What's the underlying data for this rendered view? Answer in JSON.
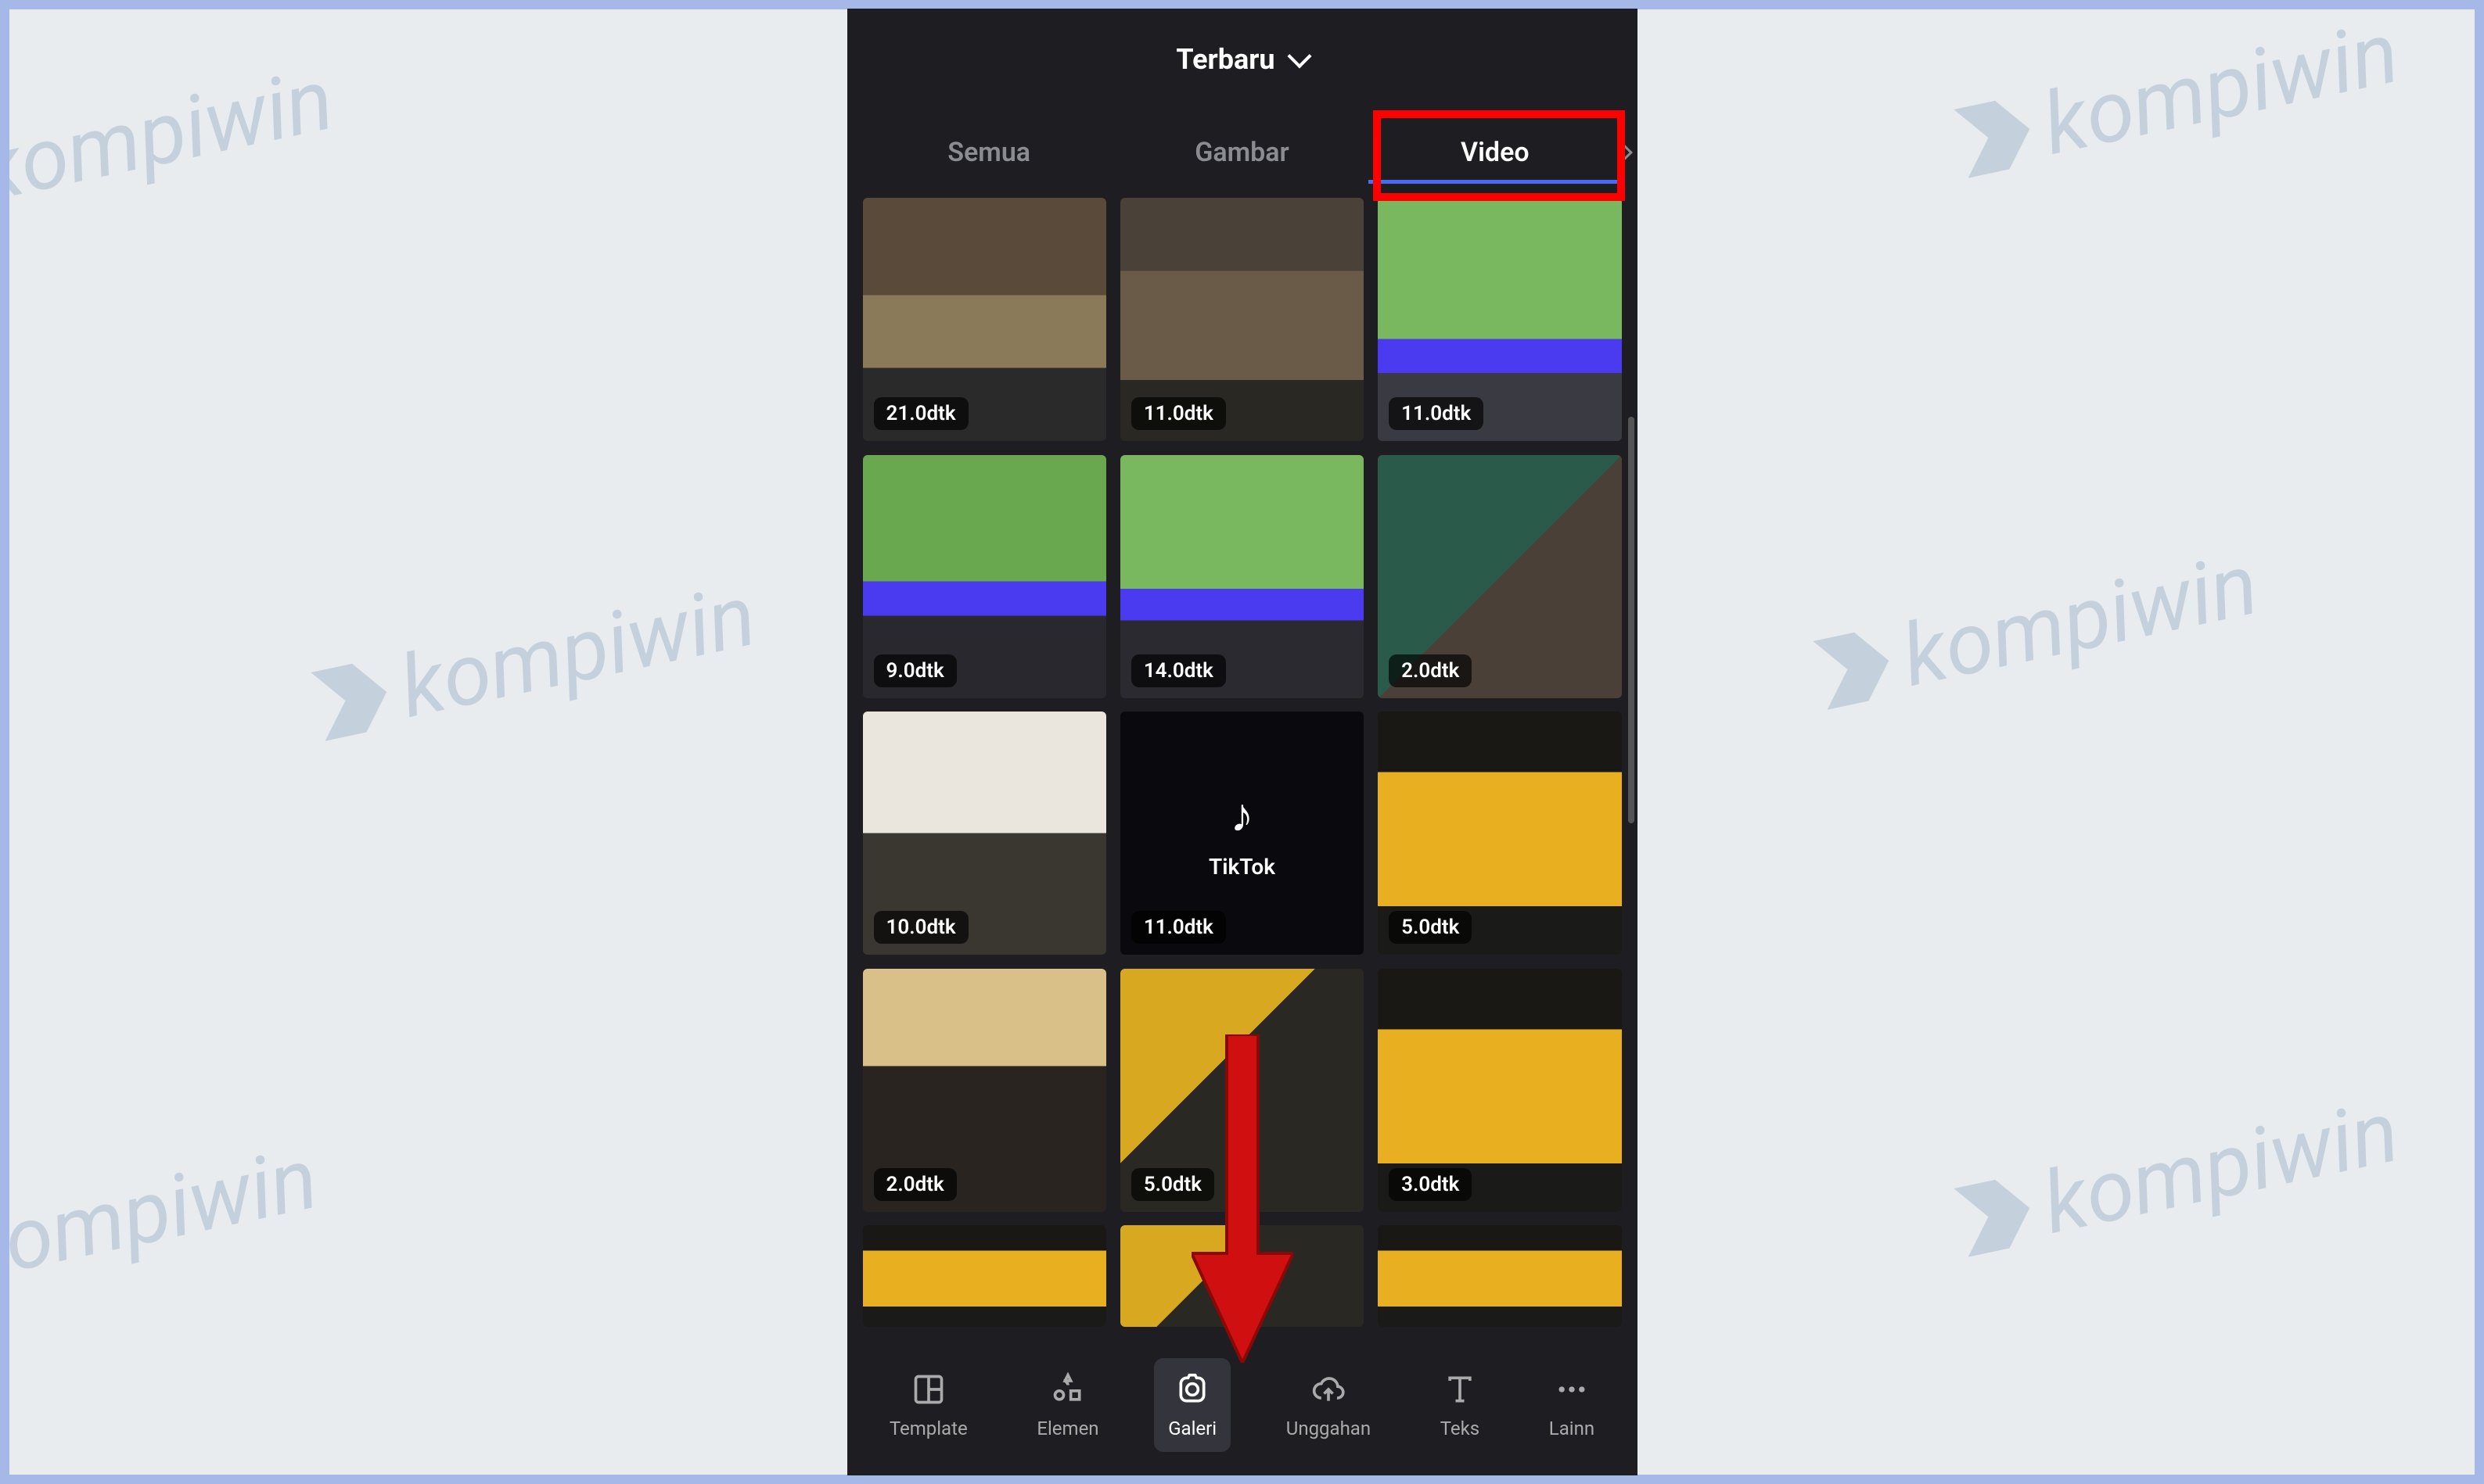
{
  "watermark_text": "kompiwin",
  "header": {
    "title": "Terbaru"
  },
  "tabs": [
    {
      "label": "Semua",
      "active": false
    },
    {
      "label": "Gambar",
      "active": false
    },
    {
      "label": "Video",
      "active": true
    }
  ],
  "thumbnails": [
    {
      "duration": "21.0dtk",
      "kind": "indoor"
    },
    {
      "duration": "11.0dtk",
      "kind": "indoor2"
    },
    {
      "duration": "11.0dtk",
      "kind": "soccer"
    },
    {
      "duration": "9.0dtk",
      "kind": "soccer2"
    },
    {
      "duration": "14.0dtk",
      "kind": "soccer3"
    },
    {
      "duration": "2.0dtk",
      "kind": "cat"
    },
    {
      "duration": "10.0dtk",
      "kind": "cat2"
    },
    {
      "duration": "11.0dtk",
      "kind": "tiktok",
      "label": "TikTok"
    },
    {
      "duration": "5.0dtk",
      "kind": "bus"
    },
    {
      "duration": "2.0dtk",
      "kind": "food"
    },
    {
      "duration": "5.0dtk",
      "kind": "bus2"
    },
    {
      "duration": "3.0dtk",
      "kind": "bus"
    },
    {
      "duration": "",
      "kind": "bus",
      "partial": true
    },
    {
      "duration": "",
      "kind": "bus2",
      "partial": true
    },
    {
      "duration": "",
      "kind": "bus",
      "partial": true
    }
  ],
  "bottom_nav": [
    {
      "label": "Template",
      "icon": "template"
    },
    {
      "label": "Elemen",
      "icon": "elements"
    },
    {
      "label": "Galeri",
      "icon": "gallery",
      "active": true
    },
    {
      "label": "Unggahan",
      "icon": "upload"
    },
    {
      "label": "Teks",
      "icon": "text"
    },
    {
      "label": "Lainn",
      "icon": "more"
    }
  ]
}
